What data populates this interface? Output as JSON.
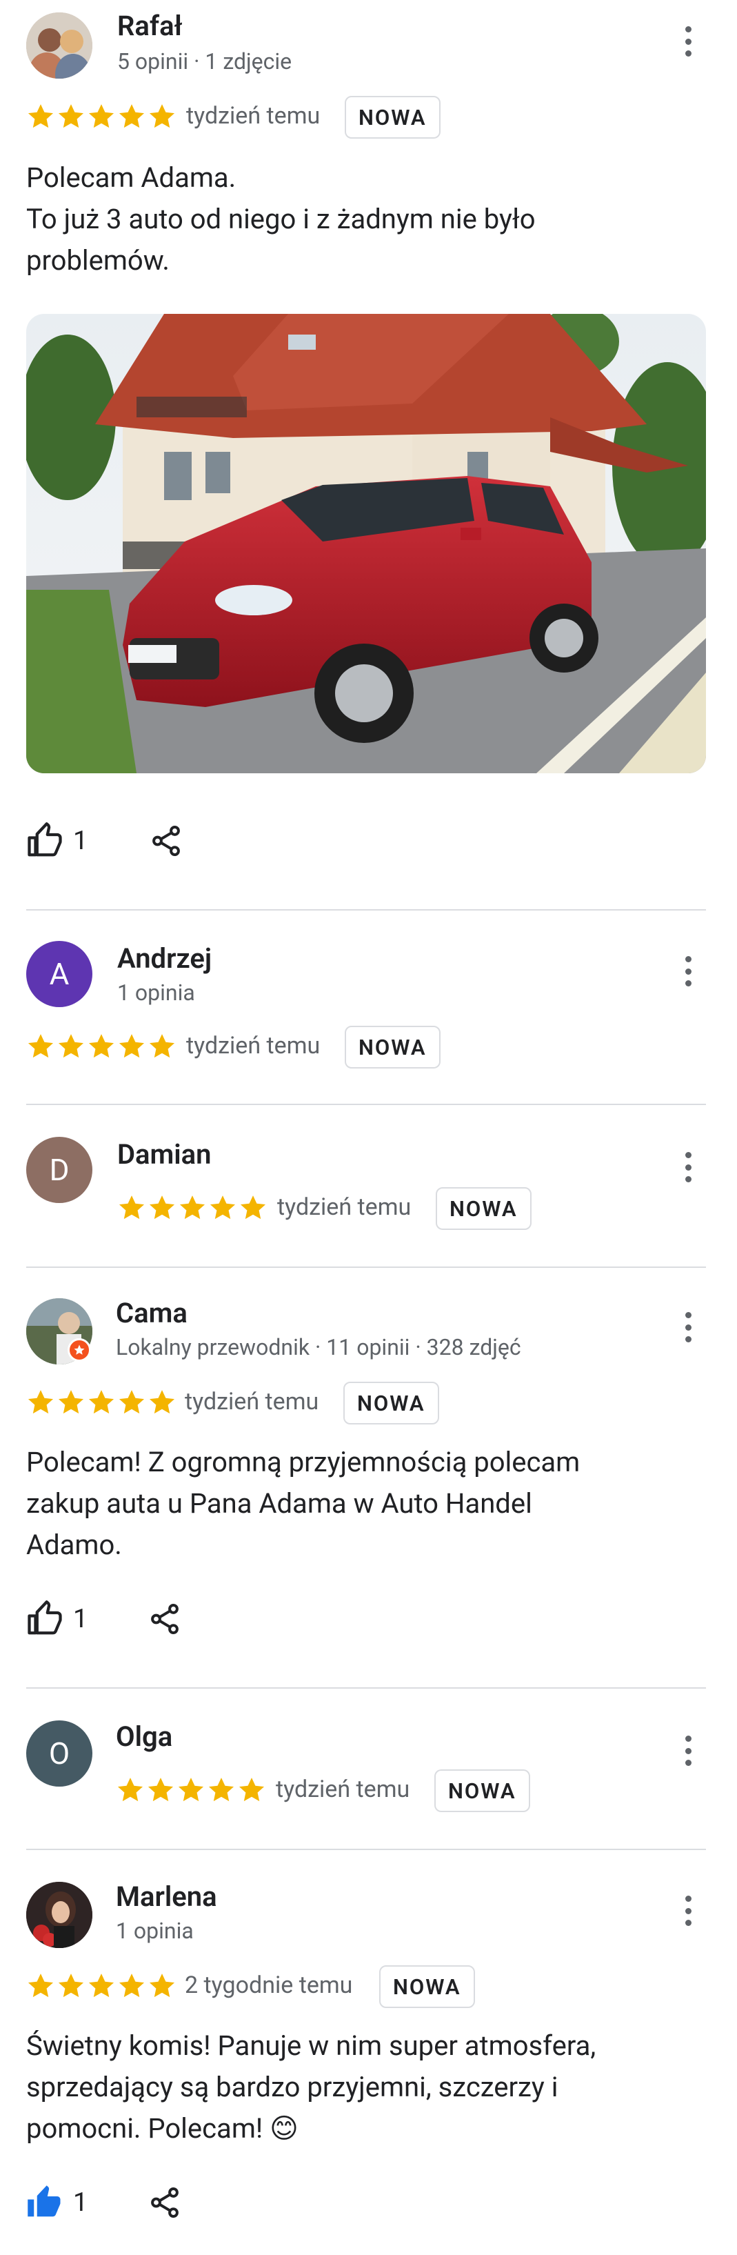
{
  "badge_label": "NOWA",
  "colors": {
    "star": "#F4B400",
    "divider": "#dadce0",
    "muted": "#5f6368",
    "liked": "#1a73e8"
  },
  "reviews": [
    {
      "name": "Rafał",
      "meta": "5 opinii · 1 zdjęcie",
      "when": "tydzień temu",
      "text": "Polecam Adama.\nTo już 3 auto od niego i z żadnym nie było problemów.",
      "likes": "1",
      "photo": "red-suv-photo"
    },
    {
      "name": "Andrzej",
      "avatar_letter": "A",
      "meta": "1 opinia",
      "when": "tydzień temu"
    },
    {
      "name": "Damian",
      "avatar_letter": "D",
      "when": "tydzień temu"
    },
    {
      "name": "Cama",
      "meta": "Lokalny przewodnik · 11 opinii · 328 zdjęć",
      "when": "tydzień temu",
      "text": "Polecam! Z ogromną przyjemnością polecam zakup auta u Pana Adama w Auto Handel Adamo.",
      "likes": "1"
    },
    {
      "name": "Olga",
      "avatar_letter": "O",
      "when": "tydzień temu"
    },
    {
      "name": "Marlena",
      "meta": "1 opinia",
      "when": "2 tygodnie temu",
      "text": "Świetny komis! Panuje w nim super atmosfera, sprzedający są bardzo przyjemni, szczerzy i pomocni. Polecam! 😊",
      "likes": "1",
      "liked": true
    }
  ]
}
